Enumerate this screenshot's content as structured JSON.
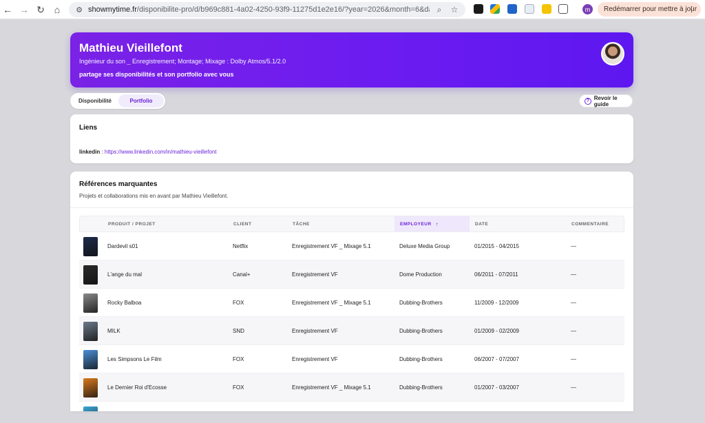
{
  "browser": {
    "url_host": "showmytime.fr",
    "url_path": "/disponibilite-pro/d/b969c881-4a02-4250-93f9-11275d1e2e16/?year=2026&month=6&day=...",
    "profile_letter": "m",
    "restart_label": "Redémarrer pour mettre à jour"
  },
  "profile": {
    "name": "Mathieu Vieillefont",
    "subtitle": "Ingénieur du son _ Enregistrement; Montage; Mixage : Dolby Atmos/5.1/2.0",
    "share_text": "partage ses disponibilités et son portfolio avec vous"
  },
  "tabs": [
    {
      "label": "Disponibilité",
      "active": false
    },
    {
      "label": "Portfolio",
      "active": true
    }
  ],
  "guide_button": {
    "label": "Revoir le guide"
  },
  "links": {
    "title": "Liens",
    "items": [
      {
        "key": "linkedin",
        "separator": " : ",
        "url": "https://www.linkedin.com/in/mathieu-vieillefont"
      }
    ]
  },
  "references": {
    "title": "Références marquantes",
    "description": "Projets et collaborations mis en avant par Mathieu Vieillefont.",
    "columns": [
      "PRODUIT / PROJET",
      "CLIENT",
      "TÂCHE",
      "EMPLOYEUR",
      "DATE",
      "COMMENTAIRE"
    ],
    "sort_icon": "↑",
    "rows": [
      {
        "product": "Dardevil s01",
        "client": "Netflix",
        "task": "Enregistrement VF _ Mixage 5.1",
        "employer": "Deluxe Media Group",
        "date": "01/2015 - 04/2015",
        "comment": "—",
        "poster_color": "#1d2a4a"
      },
      {
        "product": "L'ange du mal",
        "client": "Canal+",
        "task": "Enregistrement VF",
        "employer": "Dome Production",
        "date": "06/2011 - 07/2011",
        "comment": "—",
        "poster_color": "#2b2b2b"
      },
      {
        "product": "Rocky Balboa",
        "client": "FOX",
        "task": "Enregistrement VF _ Mixage 5.1",
        "employer": "Dubbing-Brothers",
        "date": "11/2009 - 12/2009",
        "comment": "—",
        "poster_color": "#8a8a8a"
      },
      {
        "product": "MILK",
        "client": "SND",
        "task": "Enregistrement VF",
        "employer": "Dubbing-Brothers",
        "date": "01/2009 - 02/2009",
        "comment": "—",
        "poster_color": "#6b7a8a"
      },
      {
        "product": "Les Simpsons Le Film",
        "client": "FOX",
        "task": "Enregistrement VF",
        "employer": "Dubbing-Brothers",
        "date": "06/2007 - 07/2007",
        "comment": "—",
        "poster_color": "#4b8fd6"
      },
      {
        "product": "Le Dernier Roi d'Ecosse",
        "client": "FOX",
        "task": "Enregistrement VF _ Mixage 5.1",
        "employer": "Dubbing-Brothers",
        "date": "01/2007 - 03/2007",
        "comment": "—",
        "poster_color": "#d97a1c"
      },
      {
        "product": "",
        "client": "",
        "task": "",
        "employer": "",
        "date": "",
        "comment": "",
        "poster_color": "#3aa7d8"
      }
    ]
  }
}
